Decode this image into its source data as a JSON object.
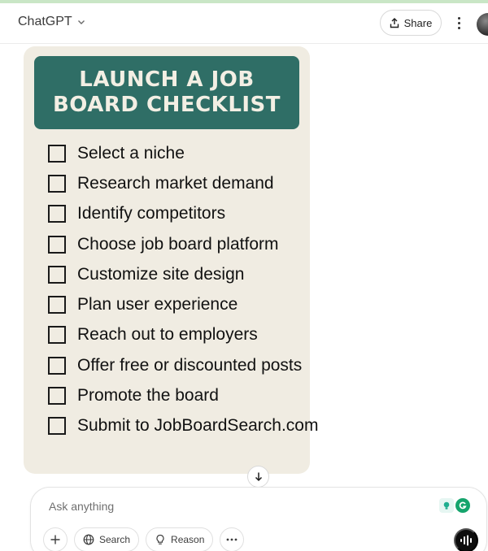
{
  "header": {
    "model_name": "ChatGPT",
    "share_label": "Share"
  },
  "image": {
    "title": "LAUNCH A JOB BOARD CHECKLIST",
    "banner_color": "#2f6e66",
    "card_color": "#f0ece2",
    "items": [
      "Select a niche",
      "Research market demand",
      "Identify competitors",
      "Choose job board platform",
      "Customize site design",
      "Plan user experience",
      "Reach out to employers",
      "Offer free or discounted posts",
      "Promote the board",
      "Submit to JobBoardSearch.com"
    ]
  },
  "composer": {
    "placeholder": "Ask anything",
    "tools": {
      "search_label": "Search",
      "reason_label": "Reason"
    }
  }
}
